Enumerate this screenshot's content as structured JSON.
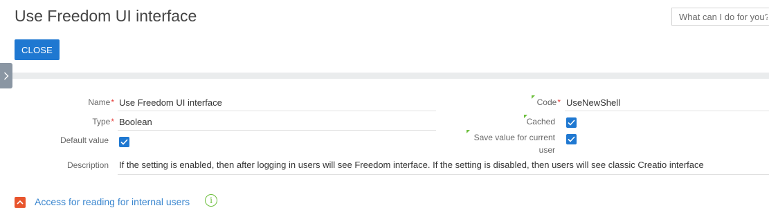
{
  "page": {
    "title": "Use Freedom UI interface"
  },
  "search": {
    "placeholder": "What can I do for you?"
  },
  "toolbar": {
    "close_label": "CLOSE"
  },
  "form": {
    "name": {
      "label": "Name",
      "required": "*",
      "value": "Use Freedom UI interface"
    },
    "type": {
      "label": "Type",
      "required": "*",
      "value": "Boolean"
    },
    "default_value": {
      "label": "Default value",
      "checked": true
    },
    "description": {
      "label": "Description",
      "value": "If the setting is enabled, then after logging in users will see Freedom interface. If the setting is disabled, then users will see classic Creatio interface"
    },
    "code": {
      "label": "Code",
      "required": "*",
      "value": "UseNewShell"
    },
    "cached": {
      "label": "Cached",
      "checked": true
    },
    "save_value": {
      "label_line1": "Save value for current",
      "label_line2": "user",
      "checked": true
    }
  },
  "section": {
    "title": "Access for reading for internal users",
    "expanded": true
  },
  "colors": {
    "accent": "#1f78d1",
    "required": "#e53935",
    "flag": "#6cbf3c",
    "section_toggle": "#e8552d",
    "link": "#3a86cf"
  },
  "icons": {
    "panel_toggle": "chevron-right-icon",
    "checkbox": "checkmark-icon",
    "section_toggle": "chevron-up-icon",
    "info": "info-icon"
  }
}
